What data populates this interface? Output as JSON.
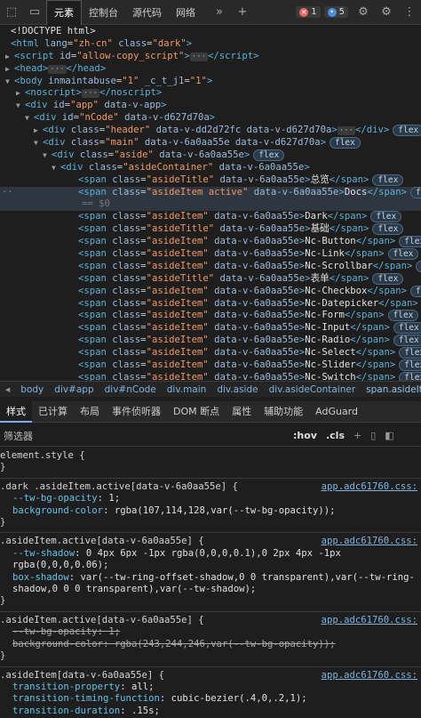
{
  "toolbar": {
    "tabs": [
      "元素",
      "控制台",
      "源代码",
      "网络"
    ],
    "errors": "1",
    "messages": "5"
  },
  "dom": [
    {
      "ind": 12,
      "html": "<span class='txt'>&lt;!DOCTYPE html&gt;</span>"
    },
    {
      "ind": 12,
      "html": "<span class='tag'>&lt;html</span> <span class='attr'>lang</span>=<span class='val'>\"zh-cn\"</span> <span class='attr'>class</span>=<span class='val'>\"dark\"</span><span class='tag'>&gt;</span>"
    },
    {
      "ind": 16,
      "tri": "▶",
      "html": "<span class='tag'>&lt;script</span> <span class='attr'>id</span>=<span class='val'>\"allow-copy_script\"</span><span class='tag'>&gt;</span><span class='ell'>···</span><span class='tag'>&lt;/script&gt;</span>"
    },
    {
      "ind": 16,
      "tri": "▶",
      "html": "<span class='tag'>&lt;head&gt;</span><span class='ell'>···</span><span class='tag'>&lt;/head&gt;</span>"
    },
    {
      "ind": 16,
      "tri": "▼",
      "html": "<span class='tag'>&lt;body</span> <span class='attr'>inmaintabuse</span>=<span class='val'>\"1\"</span> <span class='attr'>_c_t_j1</span>=<span class='val'>\"1\"</span><span class='tag'>&gt;</span>"
    },
    {
      "ind": 28,
      "tri": "▶",
      "html": "<span class='tag'>&lt;noscript&gt;</span><span class='ell'>···</span><span class='tag'>&lt;/noscript&gt;</span>"
    },
    {
      "ind": 28,
      "tri": "▼",
      "html": "<span class='tag'>&lt;div</span> <span class='attr'>id</span>=<span class='val'>\"app\"</span> <span class='attr'>data-v-app</span><span class='tag'>&gt;</span>"
    },
    {
      "ind": 38,
      "tri": "▼",
      "html": "<span class='tag'>&lt;div</span> <span class='attr'>id</span>=<span class='val'>\"nCode\"</span> <span class='attr'>data-v-d627d70a</span><span class='tag'>&gt;</span>"
    },
    {
      "ind": 48,
      "tri": "▶",
      "html": "<span class='tag'>&lt;div</span> <span class='attr'>class</span>=<span class='val'>\"header\"</span> <span class='attr'>data-v-dd2d72fc data-v-d627d70a</span><span class='tag'>&gt;</span><span class='ell'>···</span><span class='tag'>&lt;/div&gt;</span><span class='flex'>flex</span>"
    },
    {
      "ind": 48,
      "tri": "▼",
      "html": "<span class='tag'>&lt;div</span> <span class='attr'>class</span>=<span class='val'>\"main\"</span> <span class='attr'>data-v-6a0aa55e data-v-d627d70a</span><span class='tag'>&gt;</span><span class='flex'>flex</span>"
    },
    {
      "ind": 58,
      "tri": "▼",
      "html": "<span class='tag'>&lt;div</span> <span class='attr'>class</span>=<span class='val'>\"aside\"</span> <span class='attr'>data-v-6a0aa55e</span><span class='tag'>&gt;</span><span class='flex'>flex</span>"
    },
    {
      "ind": 68,
      "tri": "▼",
      "html": "<span class='tag'>&lt;div</span> <span class='attr'>class</span>=<span class='val'>\"asideContainer\"</span> <span class='attr'>data-v-6a0aa55e</span><span class='tag'>&gt;</span>"
    },
    {
      "ind": 88,
      "html": "<span class='tag'>&lt;span</span> <span class='attr'>class</span>=<span class='val'>\"asideTitle\"</span> <span class='attr'>data-v-6a0aa55e</span><span class='tag'>&gt;</span><span class='txt'>总览</span><span class='tag'>&lt;/span&gt;</span><span class='flex'>flex</span>"
    },
    {
      "ind": 88,
      "sel": true,
      "html": "<span class='tag'>&lt;span</span> <span class='attr'>class</span>=<span class='val'>\"asideItem active\"</span> <span class='attr'>data-v-6a0aa55e</span><span class='tag'>&gt;</span><span class='txt'>Docs</span><span class='tag'>&lt;/span&gt;</span><span class='flex'>flex</span>"
    },
    {
      "ind": 92,
      "sel": true,
      "html": "<span class='cmt'>== $0</span>"
    },
    {
      "ind": 88,
      "html": "<span class='tag'>&lt;span</span> <span class='attr'>class</span>=<span class='val'>\"asideItem\"</span> <span class='attr'>data-v-6a0aa55e</span><span class='tag'>&gt;</span><span class='txt'>Dark</span><span class='tag'>&lt;/span&gt;</span><span class='flex'>flex</span>"
    },
    {
      "ind": 88,
      "html": "<span class='tag'>&lt;span</span> <span class='attr'>class</span>=<span class='val'>\"asideTitle\"</span> <span class='attr'>data-v-6a0aa55e</span><span class='tag'>&gt;</span><span class='txt'>基础</span><span class='tag'>&lt;/span&gt;</span><span class='flex'>flex</span>"
    },
    {
      "ind": 88,
      "html": "<span class='tag'>&lt;span</span> <span class='attr'>class</span>=<span class='val'>\"asideItem\"</span> <span class='attr'>data-v-6a0aa55e</span><span class='tag'>&gt;</span><span class='txt'>Nc-Button</span><span class='tag'>&lt;/span&gt;</span><span class='flex'>flex</span>"
    },
    {
      "ind": 88,
      "html": "<span class='tag'>&lt;span</span> <span class='attr'>class</span>=<span class='val'>\"asideItem\"</span> <span class='attr'>data-v-6a0aa55e</span><span class='tag'>&gt;</span><span class='txt'>Nc-Link</span><span class='tag'>&lt;/span&gt;</span><span class='flex'>flex</span>"
    },
    {
      "ind": 88,
      "html": "<span class='tag'>&lt;span</span> <span class='attr'>class</span>=<span class='val'>\"asideItem\"</span> <span class='attr'>data-v-6a0aa55e</span><span class='tag'>&gt;</span><span class='txt'>Nc-Scrollbar</span><span class='tag'>&lt;/span&gt;</span><span class='flex'>flex</span>"
    },
    {
      "ind": 88,
      "html": "<span class='tag'>&lt;span</span> <span class='attr'>class</span>=<span class='val'>\"asideTitle\"</span> <span class='attr'>data-v-6a0aa55e</span><span class='tag'>&gt;</span><span class='txt'>表单</span><span class='tag'>&lt;/span&gt;</span><span class='flex'>flex</span>"
    },
    {
      "ind": 88,
      "html": "<span class='tag'>&lt;span</span> <span class='attr'>class</span>=<span class='val'>\"asideItem\"</span> <span class='attr'>data-v-6a0aa55e</span><span class='tag'>&gt;</span><span class='txt'>Nc-Checkbox</span><span class='tag'>&lt;/span&gt;</span><span class='flex'>flex</span>"
    },
    {
      "ind": 88,
      "html": "<span class='tag'>&lt;span</span> <span class='attr'>class</span>=<span class='val'>\"asideItem\"</span> <span class='attr'>data-v-6a0aa55e</span><span class='tag'>&gt;</span><span class='txt'>Nc-Datepicker</span><span class='tag'>&lt;/span&gt;</span><span class='flex'>flex</span>"
    },
    {
      "ind": 88,
      "html": "<span class='tag'>&lt;span</span> <span class='attr'>class</span>=<span class='val'>\"asideItem\"</span> <span class='attr'>data-v-6a0aa55e</span><span class='tag'>&gt;</span><span class='txt'>Nc-Form</span><span class='tag'>&lt;/span&gt;</span><span class='flex'>flex</span>"
    },
    {
      "ind": 88,
      "html": "<span class='tag'>&lt;span</span> <span class='attr'>class</span>=<span class='val'>\"asideItem\"</span> <span class='attr'>data-v-6a0aa55e</span><span class='tag'>&gt;</span><span class='txt'>Nc-Input</span><span class='tag'>&lt;/span&gt;</span><span class='flex'>flex</span>"
    },
    {
      "ind": 88,
      "html": "<span class='tag'>&lt;span</span> <span class='attr'>class</span>=<span class='val'>\"asideItem\"</span> <span class='attr'>data-v-6a0aa55e</span><span class='tag'>&gt;</span><span class='txt'>Nc-Radio</span><span class='tag'>&lt;/span&gt;</span><span class='flex'>flex</span>"
    },
    {
      "ind": 88,
      "html": "<span class='tag'>&lt;span</span> <span class='attr'>class</span>=<span class='val'>\"asideItem\"</span> <span class='attr'>data-v-6a0aa55e</span><span class='tag'>&gt;</span><span class='txt'>Nc-Select</span><span class='tag'>&lt;/span&gt;</span><span class='flex'>flex</span>"
    },
    {
      "ind": 88,
      "html": "<span class='tag'>&lt;span</span> <span class='attr'>class</span>=<span class='val'>\"asideItem\"</span> <span class='attr'>data-v-6a0aa55e</span><span class='tag'>&gt;</span><span class='txt'>Nc-Slider</span><span class='tag'>&lt;/span&gt;</span><span class='flex'>flex</span>"
    },
    {
      "ind": 88,
      "html": "<span class='tag'>&lt;span</span> <span class='attr'>class</span>=<span class='val'>\"asideItem\"</span> <span class='attr'>data-v-6a0aa55e</span><span class='tag'>&gt;</span><span class='txt'>Nc-Switch</span><span class='tag'>&lt;/span&gt;</span><span class='flex'>flex</span>"
    }
  ],
  "breadcrumbs": [
    "body",
    "div#app",
    "div#nCode",
    "div.main",
    "div.aside",
    "div.asideContainer",
    "span.asideItem.active"
  ],
  "panel_tabs": [
    "样式",
    "已计算",
    "布局",
    "事件侦听器",
    "DOM 断点",
    "属性",
    "辅助功能",
    "AdGuard"
  ],
  "filter": {
    "placeholder": "筛选器",
    "hov": ":hov",
    "cls": ".cls"
  },
  "rules": [
    {
      "selector": "element.style {",
      "src": "",
      "props": [],
      "strike": false
    },
    {
      "selector": ".dark .asideItem.active[data-v-6a0aa55e] {",
      "src": "app.adc61760.css:",
      "props": [
        [
          "--tw-bg-opacity",
          "1;"
        ],
        [
          "background-color",
          "rgba(107,114,128,var(--tw-bg-opacity));"
        ]
      ],
      "strike": false
    },
    {
      "selector": ".asideItem.active[data-v-6a0aa55e] {",
      "src": "app.adc61760.css:",
      "props": [
        [
          "--tw-shadow",
          "0 4px 6px -1px rgba(0,0,0,0.1),0 2px 4px -1px rgba(0,0,0,0.06);"
        ],
        [
          "box-shadow",
          "var(--tw-ring-offset-shadow,0 0 transparent),var(--tw-ring-shadow,0 0 0 transparent),var(--tw-shadow);"
        ]
      ],
      "strike": false
    },
    {
      "selector": ".asideItem.active[data-v-6a0aa55e] {",
      "src": "app.adc61760.css:",
      "props": [
        [
          "--tw-bg-opacity",
          "1;"
        ],
        [
          "background-color",
          "rgba(243,244,246,var(--tw-bg-opacity));"
        ]
      ],
      "strike": true
    },
    {
      "selector": ".asideItem[data-v-6a0aa55e] {",
      "src": "app.adc61760.css:",
      "props": [
        [
          "transition-property",
          "all;"
        ],
        [
          "transition-timing-function",
          "cubic-bezier(.4,0,.2,1);"
        ],
        [
          "transition-duration",
          ".15s;"
        ]
      ],
      "strike": false
    }
  ]
}
